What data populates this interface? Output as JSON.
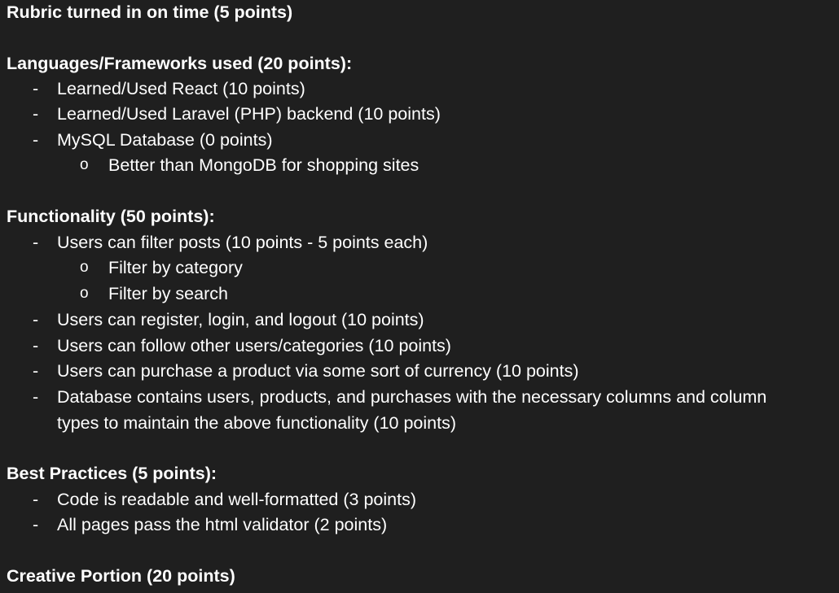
{
  "sections": {
    "rubric": {
      "heading": "Rubric turned in on time (5 points)"
    },
    "languages": {
      "heading": "Languages/Frameworks used (20 points):",
      "items": [
        "Learned/Used React (10 points)",
        "Learned/Used Laravel (PHP) backend (10 points)",
        "MySQL Database (0 points)"
      ],
      "subitems": [
        "Better than MongoDB for shopping sites"
      ]
    },
    "functionality": {
      "heading": "Functionality (50 points):",
      "items": [
        "Users can filter posts (10 points - 5 points each)",
        "Users can register, login, and logout (10 points)",
        "Users can follow other users/categories (10 points)",
        "Users can purchase a product via some sort of currency (10 points)",
        "Database contains users, products, and purchases with the necessary columns and column",
        "types to maintain the above functionality (10 points)"
      ],
      "subitems": [
        "Filter by category",
        "Filter by search"
      ]
    },
    "best_practices": {
      "heading": "Best Practices (5 points):",
      "items": [
        " Code is readable and well-formatted (3 points)",
        "All pages pass the html validator (2 points)"
      ]
    },
    "creative": {
      "heading": "Creative Portion (20 points)"
    }
  },
  "glyphs": {
    "dash": "-",
    "bullet": "o"
  },
  "colors": {
    "background": "#1f1f1f",
    "text": "#ffffff"
  }
}
